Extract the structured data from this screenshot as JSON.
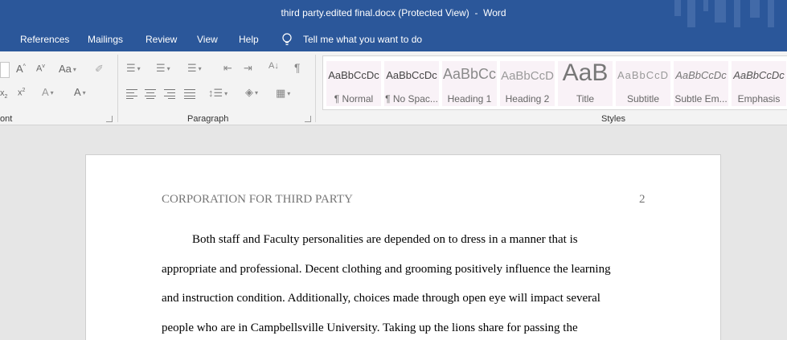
{
  "window": {
    "title": "third party.edited final.docx (Protected View)  -  Word"
  },
  "tabs": [
    "References",
    "Mailings",
    "Review",
    "View",
    "Help"
  ],
  "tell_me": "Tell me what you want to do",
  "ribbon": {
    "groups": {
      "font": "ont",
      "paragraph": "Paragraph",
      "styles": "Styles"
    },
    "font_icons": {
      "grow": "A",
      "shrink": "A",
      "case": "Aa",
      "sub": "x",
      "sup": "x",
      "effects": "A",
      "color": "A"
    },
    "paragraph_icons": {
      "sort": "A↓",
      "pilcrow": "¶"
    }
  },
  "styles": [
    {
      "preview": "AaBbCcDc",
      "name": "¶ Normal"
    },
    {
      "preview": "AaBbCcDc",
      "name": "¶ No Spac..."
    },
    {
      "preview": "AaBbCc",
      "name": "Heading 1"
    },
    {
      "preview": "AaBbCcD",
      "name": "Heading 2"
    },
    {
      "preview": "AaB",
      "name": "Title"
    },
    {
      "preview": "AaBbCcD",
      "name": "Subtitle"
    },
    {
      "preview": "AaBbCcDc",
      "name": "Subtle Em..."
    },
    {
      "preview": "AaBbCcDc",
      "name": "Emphasis"
    }
  ],
  "document": {
    "header": "CORPORATION FOR THIRD PARTY",
    "page_number": "2",
    "lines": [
      "Both staff and Faculty personalities are depended on to dress in a manner that is",
      "appropriate and professional. Decent clothing and grooming positively influence the learning",
      "and instruction condition. Additionally, choices made through open eye will impact several",
      "people who are in Campbellsville University. Taking up the lions share for passing the"
    ]
  },
  "colors": {
    "accent": "#2b579a",
    "ribbon": "#f3f3f3",
    "canvas": "#e6e6e6"
  }
}
